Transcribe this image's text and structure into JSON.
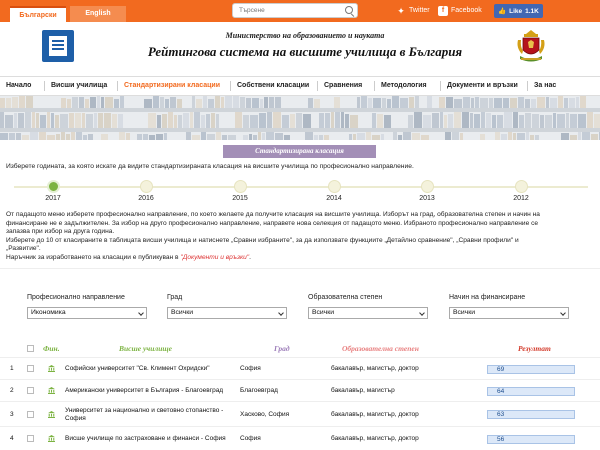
{
  "topbar": {
    "lang_bg": "Български",
    "lang_en": "English",
    "search_placeholder": "Търсене",
    "twitter": "Twitter",
    "facebook": "Facebook",
    "like_label": "Like",
    "like_count": "1.1K"
  },
  "header": {
    "ministry": "Министерство на образованието и науката",
    "system": "Рейтингова система на висшите училища в България"
  },
  "nav": [
    {
      "label": "Начало",
      "active": false
    },
    {
      "label": "Висши училища",
      "active": false
    },
    {
      "label": "Стандартизирани класации",
      "active": true
    },
    {
      "label": "Собствени класации",
      "active": false
    },
    {
      "label": "Сравнения",
      "active": false
    },
    {
      "label": "Методология",
      "active": false
    },
    {
      "label": "Документи и връзки",
      "active": false
    },
    {
      "label": "За нас",
      "active": false
    }
  ],
  "page_title": "Стандартизирана класация",
  "instruction": "Изберете годината, за която искате да видите стандартизираната класация на висшите училища по професионално направление.",
  "timeline": {
    "years": [
      "2017",
      "2016",
      "2015",
      "2014",
      "2013",
      "2012"
    ],
    "active": "2017"
  },
  "paragraph": {
    "line1": "От падащото меню изберете професионално направление, по което желаете да получите класация на висшите училища. Изборът на град, образователна степен и начин на",
    "line2": "финансиране не е задължителен. За избор на друго професионално направление, направете нова селекция от падащото меню. Избраното професионално направление се",
    "line3": "запазва при избор на друга година.",
    "line4": "Изберете до 10 от класираните в таблицата висши училища и натиснете „Сравни избраните\", за да използвате функциите „Детайлно сравнение\", „Сравни профили\" и",
    "line5": "„Развитие\".",
    "line6": "Наръчник за изработването на класации е публикуван в ",
    "line6_link": "\"Документи и връзки\"",
    "line6_end": "."
  },
  "filters": [
    {
      "label": "Професионално направление",
      "value": "Икономика"
    },
    {
      "label": "Град",
      "value": "Всички"
    },
    {
      "label": "Образователна степен",
      "value": "Всички"
    },
    {
      "label": "Начин на финансиране",
      "value": "Всички"
    }
  ],
  "table": {
    "headers": {
      "fin": "Фин.",
      "school": "Висше училище",
      "city": "Град",
      "degree": "Образователна степен",
      "result": "Резултат"
    },
    "colors": {
      "fin": "#7cb342",
      "school": "#7cb342",
      "city": "#9b7bb8",
      "degree": "#e88080",
      "result": "#d33a2a"
    },
    "rows": [
      {
        "rank": "1",
        "fin": "state",
        "school": "Софийски университет \"Св. Климент Охридски\"",
        "city": "София",
        "degree": "бакалавър, магистър, доктор",
        "result": "69"
      },
      {
        "rank": "2",
        "fin": "state",
        "school": "Американски университет в България - Благоевград",
        "city": "Благоевград",
        "degree": "бакалавър, магистър",
        "result": "64"
      },
      {
        "rank": "3",
        "fin": "state",
        "school": "Университет за национално и световно стопанство - София",
        "city": "Хасково, София",
        "degree": "бакалавър, магистър, доктор",
        "result": "63"
      },
      {
        "rank": "4",
        "fin": "state",
        "school": "Висше училище по застраховане и финанси - София",
        "city": "София",
        "degree": "бакалавър, магистър, доктор",
        "result": "56"
      }
    ]
  },
  "colors": {
    "brand": "#f26a1f",
    "pill": "#a38fb7",
    "timeline_active": "#7cb342",
    "bar_fill": "#dce8f8"
  }
}
